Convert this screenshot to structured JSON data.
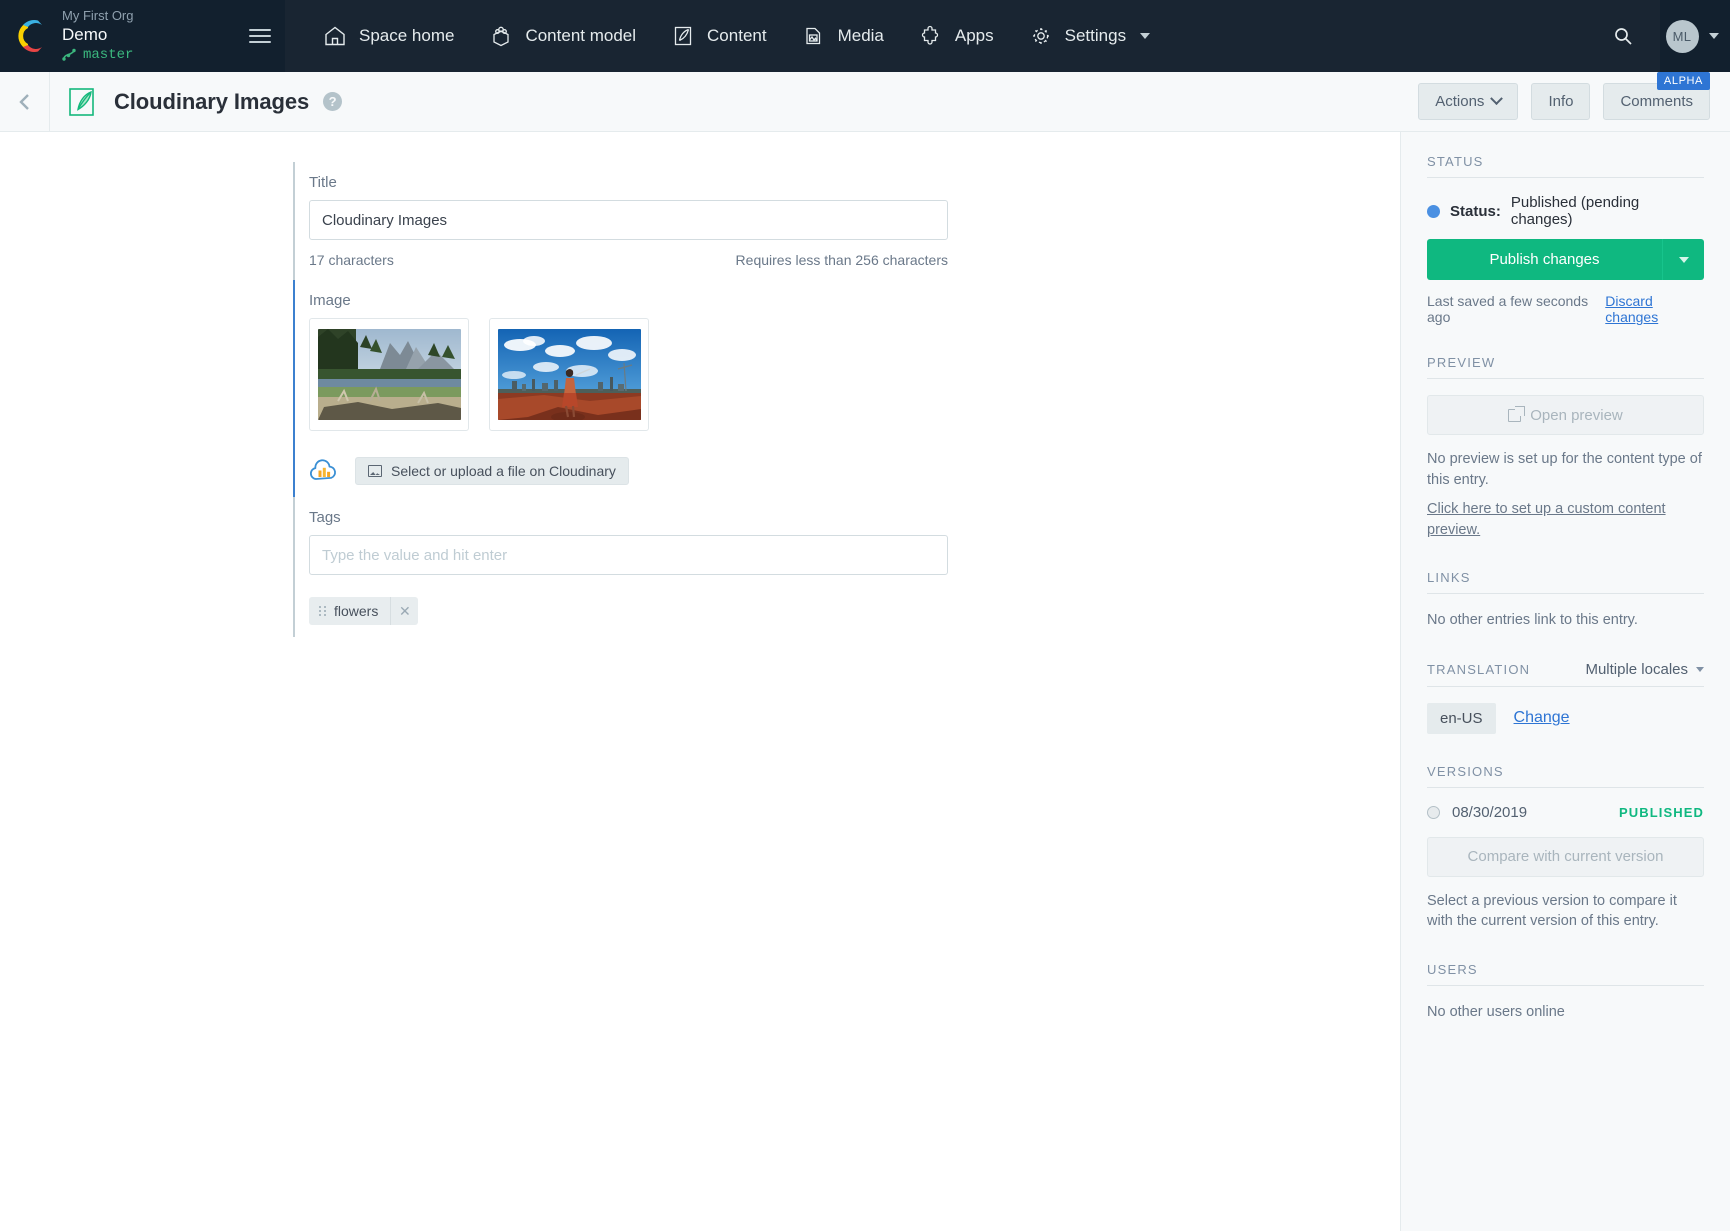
{
  "topnav": {
    "org_name": "My First Org",
    "space_name": "Demo",
    "branch": "master",
    "logo_icon": "contentful-logo-icon",
    "menu_icon": "hamburger-menu-icon",
    "search_icon": "search-icon",
    "avatar_initials": "ML",
    "items": [
      {
        "label": "Space home",
        "icon": "home-icon"
      },
      {
        "label": "Content model",
        "icon": "content-model-icon"
      },
      {
        "label": "Content",
        "icon": "content-pen-icon"
      },
      {
        "label": "Media",
        "icon": "media-image-icon"
      },
      {
        "label": "Apps",
        "icon": "apps-puzzle-icon"
      },
      {
        "label": "Settings",
        "icon": "gear-icon",
        "has_caret": true
      }
    ]
  },
  "subheader": {
    "back_icon": "chevron-left-icon",
    "entry_icon": "content-type-pen-icon",
    "title": "Cloudinary Images",
    "help_icon": "question-mark-icon",
    "actions_label": "Actions",
    "info_label": "Info",
    "comments_label": "Comments",
    "alpha_badge": "ALPHA"
  },
  "form": {
    "title_field": {
      "label": "Title",
      "value": "Cloudinary Images",
      "char_count": "17 characters",
      "constraint": "Requires less than 256 characters"
    },
    "image_field": {
      "label": "Image",
      "remove_icon": "close-x-icon",
      "thumbnails": [
        {
          "alt": "Yosemite valley with pine trees, river and granite cliffs"
        },
        {
          "alt": "Person standing on red earth under blue sky with clouds and city skyline"
        }
      ],
      "cloudinary_logo_icon": "cloudinary-cloud-icon",
      "upload_button_label": "Select or upload a file on Cloudinary",
      "upload_button_icon": "image-icon"
    },
    "tags_field": {
      "label": "Tags",
      "input_value": "",
      "placeholder": "Type the value and hit enter",
      "tags": [
        {
          "label": "flowers",
          "drag_icon": "drag-handle-icon",
          "remove_icon": "close-x-icon"
        }
      ]
    }
  },
  "sidebar": {
    "status": {
      "heading": "STATUS",
      "status_prefix": "Status:",
      "status_value": "Published (pending changes)",
      "status_color": "#4a90e2",
      "publish_label": "Publish changes",
      "publish_color": "#0fb880",
      "publish_caret_icon": "chevron-down-icon",
      "saved_text": "Last saved a few seconds ago",
      "discard_label": "Discard changes"
    },
    "preview": {
      "heading": "PREVIEW",
      "open_preview_label": "Open preview",
      "open_preview_icon": "external-link-icon",
      "note": "No preview is set up for the content type of this entry.",
      "setup_link": "Click here to set up a custom content preview."
    },
    "links": {
      "heading": "LINKS",
      "note": "No other entries link to this entry."
    },
    "translation": {
      "heading": "TRANSLATION",
      "selector_label": "Multiple locales",
      "selector_icon": "chevron-down-icon",
      "locale_chip": "en-US",
      "change_label": "Change"
    },
    "versions": {
      "heading": "VERSIONS",
      "rows": [
        {
          "date": "08/30/2019",
          "state": "PUBLISHED"
        }
      ],
      "compare_label": "Compare with current version",
      "note": "Select a previous version to compare it with the current version of this entry."
    },
    "users": {
      "heading": "USERS",
      "note": "No other users online"
    }
  }
}
